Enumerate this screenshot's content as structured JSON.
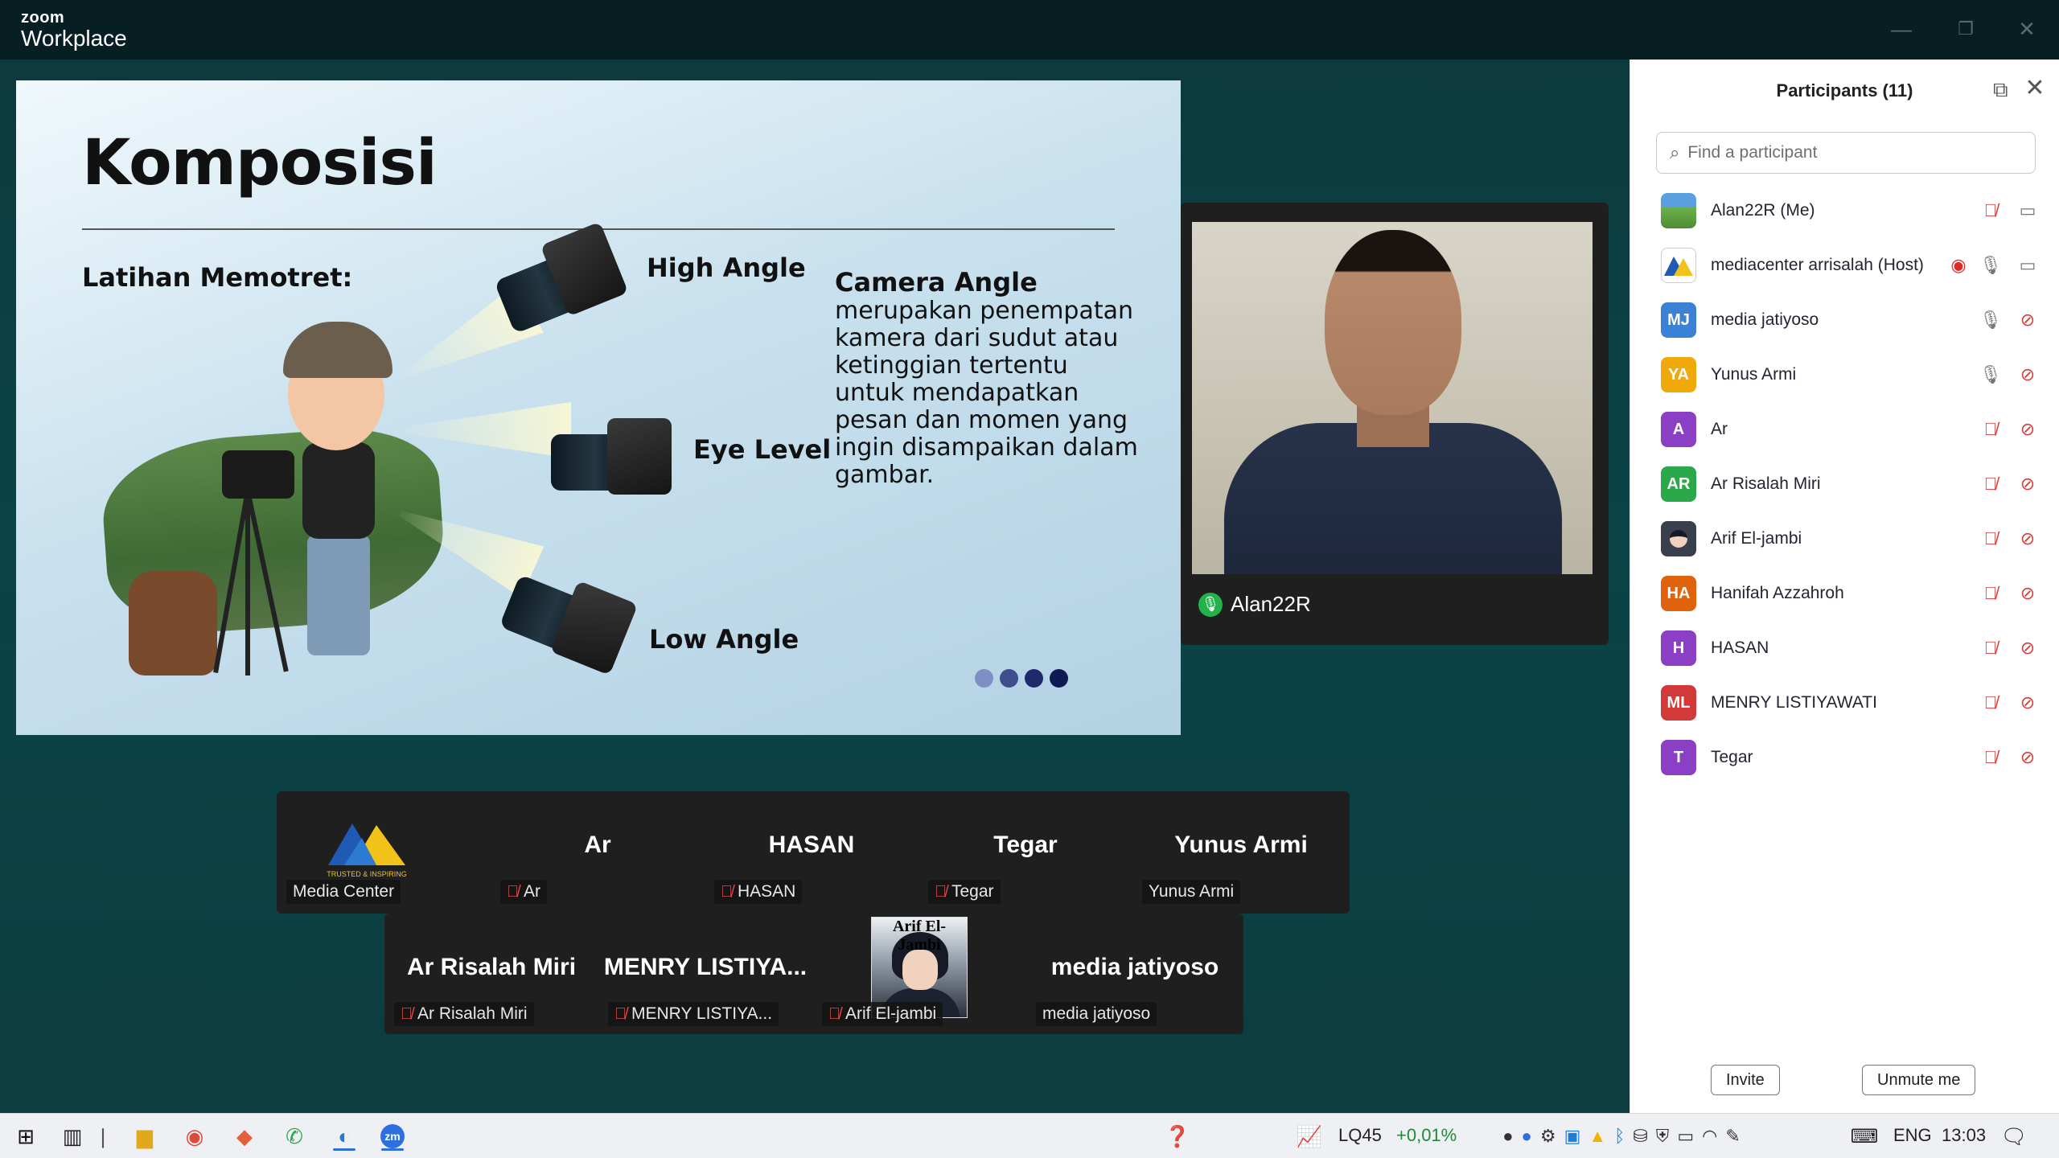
{
  "app": {
    "logo_line1": "zoom",
    "logo_line2": "Workplace"
  },
  "window_controls": {
    "minimize": "—",
    "maximize": "❐",
    "close": "✕"
  },
  "slide": {
    "title": "Komposisi",
    "subtitle": "Latihan Memotret:",
    "angles": {
      "high": "High Angle",
      "eye": "Eye Level",
      "low": "Low Angle"
    },
    "camera_angle_title": "Camera Angle",
    "camera_angle_body": "merupakan penempatan kamera dari sudut atau ketinggian tertentu untuk mendapatkan pesan dan momen yang ingin disampaikan dalam gambar.",
    "dot_colors": [
      "#7d8fc4",
      "#3f4f8e",
      "#1f2a6b",
      "#0f1a55"
    ]
  },
  "self_video": {
    "name": "Alan22R"
  },
  "gallery": {
    "row1": [
      {
        "big": "",
        "label": "Media Center",
        "muted": false,
        "logo_text": "TRUSTED & INSPIRING"
      },
      {
        "big": "Ar",
        "label": "Ar",
        "muted": true
      },
      {
        "big": "HASAN",
        "label": "HASAN",
        "muted": true
      },
      {
        "big": "Tegar",
        "label": "Tegar",
        "muted": true
      },
      {
        "big": "Yunus Armi",
        "label": "Yunus Armi",
        "muted": false
      }
    ],
    "row2": [
      {
        "big": "Ar Risalah Miri",
        "label": "Ar Risalah Miri",
        "muted": true
      },
      {
        "big": "MENRY  LISTIYA...",
        "label": "MENRY LISTIYA...",
        "muted": true
      },
      {
        "big": "",
        "label": "Arif El-jambi",
        "muted": true,
        "avatar_caption": "Arif El-Jambi"
      },
      {
        "big": "media jatiyoso",
        "label": "media jatiyoso",
        "muted": false
      }
    ]
  },
  "participants": {
    "header": "Participants (11)",
    "search_placeholder": "Find a participant",
    "list": [
      {
        "name": "Alan22R (Me)",
        "initials": "",
        "color": "#4a8fd0",
        "mic": "muted",
        "cam": "on"
      },
      {
        "name": "mediacenter arrisalah (Host)",
        "initials": "",
        "color": "#ffffff",
        "mic": "on",
        "cam": "on",
        "recording": true
      },
      {
        "name": "media jatiyoso",
        "initials": "MJ",
        "color": "#3b82d6",
        "mic": "on",
        "cam": "off"
      },
      {
        "name": "Yunus Armi",
        "initials": "YA",
        "color": "#f0a90a",
        "mic": "on",
        "cam": "off"
      },
      {
        "name": "Ar",
        "initials": "A",
        "color": "#8a3fc4",
        "mic": "muted",
        "cam": "off"
      },
      {
        "name": "Ar Risalah Miri",
        "initials": "AR",
        "color": "#2aa84a",
        "mic": "muted",
        "cam": "off"
      },
      {
        "name": "Arif El-jambi",
        "initials": "",
        "color": "#3a3f4d",
        "mic": "muted",
        "cam": "off"
      },
      {
        "name": "Hanifah Azzahroh",
        "initials": "HA",
        "color": "#e0620c",
        "mic": "muted",
        "cam": "off"
      },
      {
        "name": "HASAN",
        "initials": "H",
        "color": "#8a3fc4",
        "mic": "muted",
        "cam": "off"
      },
      {
        "name": "MENRY LISTIYAWATI",
        "initials": "ML",
        "color": "#d23a3a",
        "mic": "muted",
        "cam": "off"
      },
      {
        "name": "Tegar",
        "initials": "T",
        "color": "#8a3fc4",
        "mic": "muted",
        "cam": "off"
      }
    ],
    "invite_label": "Invite",
    "unmute_label": "Unmute me"
  },
  "taskbar": {
    "stock_ticker": "LQ45",
    "stock_change": "+0,01%",
    "language": "ENG",
    "time": "13:03"
  }
}
